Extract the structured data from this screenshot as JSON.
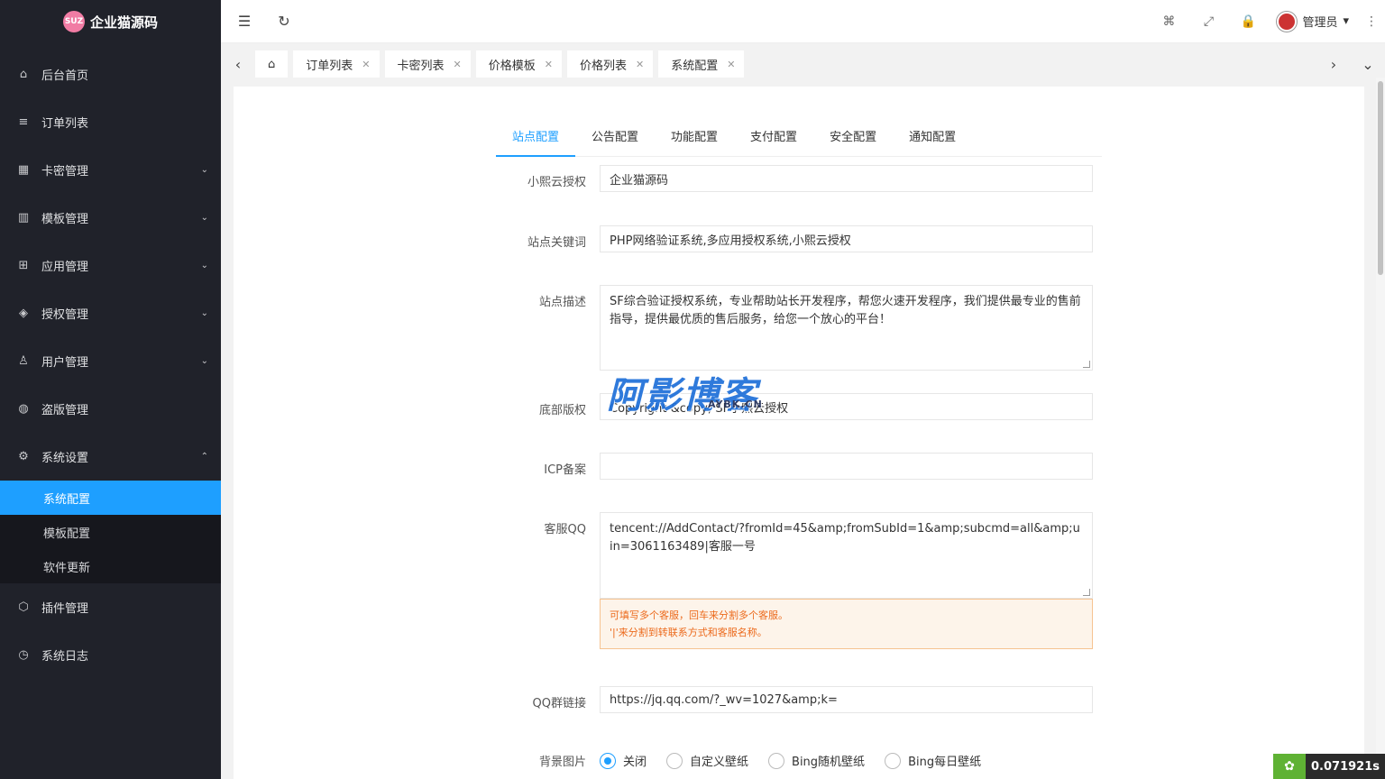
{
  "app": {
    "title": "企业猫源码",
    "logo_text": "SUZ"
  },
  "sidebar": {
    "items": [
      {
        "label": "后台首页",
        "icon": "⌂"
      },
      {
        "label": "订单列表",
        "icon": "≡"
      },
      {
        "label": "卡密管理",
        "icon": "▦",
        "arrow": "⌄"
      },
      {
        "label": "模板管理",
        "icon": "▥",
        "arrow": "⌄"
      },
      {
        "label": "应用管理",
        "icon": "⊞",
        "arrow": "⌄"
      },
      {
        "label": "授权管理",
        "icon": "◈",
        "arrow": "⌄"
      },
      {
        "label": "用户管理",
        "icon": "♙",
        "arrow": "⌄"
      },
      {
        "label": "盗版管理",
        "icon": "◍"
      },
      {
        "label": "系统设置",
        "icon": "⚙",
        "arrow": "⌃"
      }
    ],
    "sub_items": [
      {
        "label": "系统配置"
      },
      {
        "label": "模板配置"
      },
      {
        "label": "软件更新"
      }
    ],
    "after_items": [
      {
        "label": "插件管理",
        "icon": "⬡"
      },
      {
        "label": "系统日志",
        "icon": "◷"
      }
    ]
  },
  "header": {
    "menu_icon": "☰",
    "refresh_icon": "↻",
    "tag_icon": "⌘",
    "fullscreen_icon": "⤢",
    "lock_icon": "🔒",
    "user_name": "管理员",
    "user_caret": "▾",
    "more_icon": "⋮"
  },
  "tabbar": {
    "prev_icon": "‹",
    "home_icon": "⌂",
    "next_icon": "›",
    "dropdown_icon": "⌄",
    "close_icon": "✕",
    "tabs": [
      "订单列表",
      "卡密列表",
      "价格模板",
      "价格列表",
      "系统配置"
    ]
  },
  "form_tabs": [
    "站点配置",
    "公告配置",
    "功能配置",
    "支付配置",
    "安全配置",
    "通知配置"
  ],
  "form": {
    "auth": {
      "label": "小熙云授权",
      "value": "企业猫源码"
    },
    "keywords": {
      "label": "站点关键词",
      "value": "PHP网络验证系统,多应用授权系统,小熙云授权"
    },
    "desc": {
      "label": "站点描述",
      "value": "SF综合验证授权系统，专业帮助站长开发程序，帮您火速开发程序，我们提供最专业的售前指导，提供最优质的售后服务，给您一个放心的平台！"
    },
    "footer": {
      "label": "底部版权",
      "value": "Copyright &copy; SF小熙云授权"
    },
    "icp": {
      "label": "ICP备案",
      "value": ""
    },
    "qq": {
      "label": "客服QQ",
      "value": "tencent://AddContact/?fromId=45&amp;fromSubId=1&amp;subcmd=all&amp;uin=3061163489|客服一号"
    },
    "qq_tip_1": "可填写多个客服，回车来分割多个客服。",
    "qq_tip_2": "'|'来分割到转联系方式和客服名称。",
    "qqgroup": {
      "label": "QQ群链接",
      "value": "https://jq.qq.com/?_wv=1027&amp;k="
    },
    "bg": {
      "label": "背景图片",
      "options": [
        "关闭",
        "自定义壁纸",
        "Bing随机壁纸",
        "Bing每日壁纸"
      ],
      "selected": "关闭"
    }
  },
  "watermark": {
    "text": "阿影博客",
    "sub": "AYBK.CN"
  },
  "timer": {
    "value": "0.071921s"
  },
  "colors": {
    "accent": "#1e9fff",
    "sidebar_bg": "#20222a",
    "warning": "#ec6a1c"
  }
}
